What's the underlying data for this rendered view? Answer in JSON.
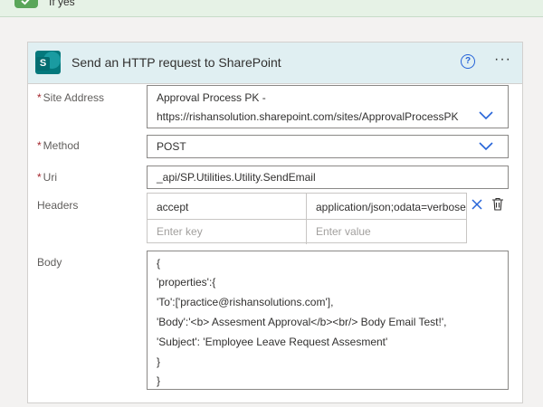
{
  "branch": {
    "label": "If yes"
  },
  "card": {
    "title": "Send an HTTP request to SharePoint",
    "logo_letter": "S",
    "help_glyph": "?",
    "more_glyph": "···"
  },
  "fields": {
    "site_address": {
      "label": "Site Address",
      "required": "*",
      "value_line1": "Approval Process PK -",
      "value_line2": "https://rishansolution.sharepoint.com/sites/ApprovalProcessPK"
    },
    "method": {
      "label": "Method",
      "required": "*",
      "value": "POST"
    },
    "uri": {
      "label": "Uri",
      "required": "*",
      "value": "_api/SP.Utilities.Utility.SendEmail"
    },
    "headers": {
      "label": "Headers",
      "rows": [
        {
          "key": "accept",
          "value": "application/json;odata=verbose"
        }
      ],
      "key_placeholder": "Enter key",
      "value_placeholder": "Enter value"
    },
    "body": {
      "label": "Body",
      "lines": [
        "{",
        "'properties':{",
        "'To':['practice@rishansolutions.com'],",
        "'Body':'<b> Assesment Approval</b><br/> Body Email Test!',",
        "'Subject': 'Employee Leave Request Assesment'",
        "}",
        "}"
      ]
    }
  },
  "colors": {
    "accent": "#2563d8",
    "required": "#a4262c",
    "header_bg": "#e0eff2",
    "sharepoint": "#03787c"
  },
  "icons": [
    "check-icon",
    "sharepoint-logo-icon",
    "help-icon",
    "more-options-icon",
    "chevron-down-icon",
    "close-icon",
    "delete-icon"
  ]
}
